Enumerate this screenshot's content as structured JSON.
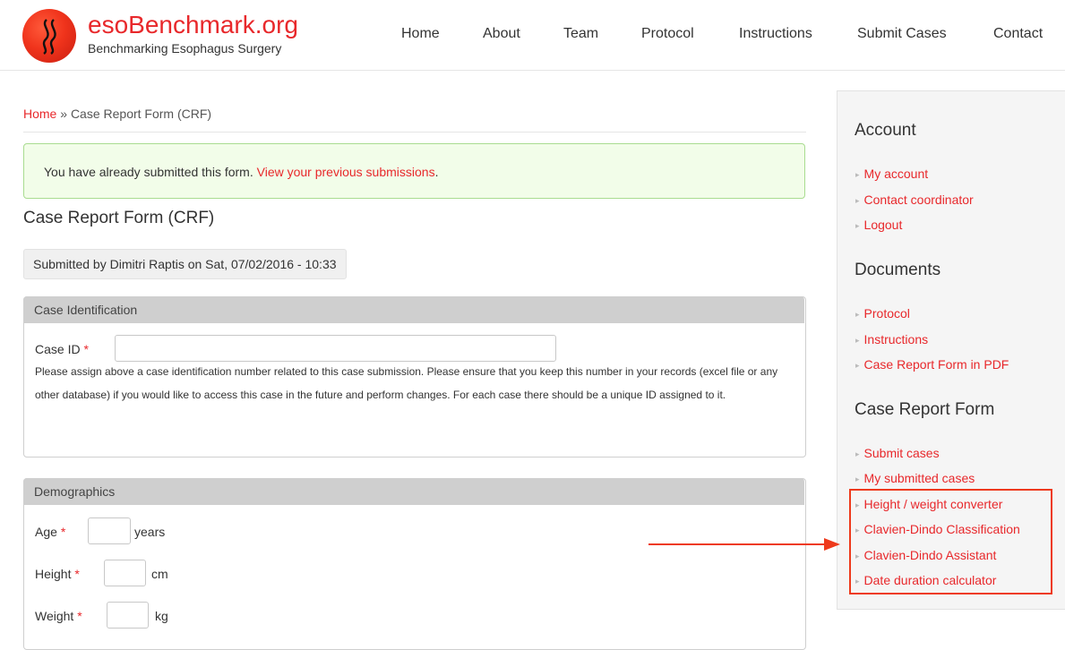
{
  "site": {
    "name": "esoBenchmark.org",
    "slogan": "Benchmarking Esophagus Surgery"
  },
  "nav": [
    "Home",
    "About",
    "Team",
    "Protocol",
    "Instructions",
    "Submit Cases",
    "Contact"
  ],
  "breadcrumb": {
    "home": "Home",
    "separator": " » ",
    "current": "Case Report Form (CRF)"
  },
  "alert": {
    "text": "You have already submitted this form. ",
    "link": "View your previous submissions",
    "end": "."
  },
  "page_title": "Case Report Form (CRF)",
  "submitted_by": "Submitted by Dimitri Raptis on Sat, 07/02/2016 - 10:33",
  "case_identification": {
    "legend": "Case Identification",
    "case_id_label": "Case ID",
    "required_mark": "*",
    "case_id_value": "",
    "description": "Please assign above a case identification number related to this case submission. Please ensure that you keep this number in your records (excel file or any other database) if you would like to access this case in the future and perform changes. For each case there should be a unique ID assigned to it."
  },
  "demographics": {
    "legend": "Demographics",
    "age": {
      "label": "Age",
      "unit": "years",
      "value": ""
    },
    "height": {
      "label": "Height",
      "unit": "cm",
      "value": ""
    },
    "weight": {
      "label": "Weight",
      "unit": "kg",
      "value": ""
    }
  },
  "sidebar": {
    "account": {
      "title": "Account",
      "links": [
        "My account",
        "Contact coordinator",
        "Logout"
      ]
    },
    "documents": {
      "title": "Documents",
      "links": [
        "Protocol",
        "Instructions",
        "Case Report Form in PDF"
      ]
    },
    "crf": {
      "title": "Case Report Form",
      "links": [
        "Submit cases",
        "My submitted cases",
        "Height / weight converter",
        "Clavien-Dindo Classification",
        "Clavien-Dindo Assistant",
        "Date duration calculator"
      ]
    }
  },
  "colors": {
    "accent": "#e8282b",
    "highlight": "#ee3a1c",
    "alert_bg": "#f2fde9",
    "alert_border": "#a9dc90"
  }
}
